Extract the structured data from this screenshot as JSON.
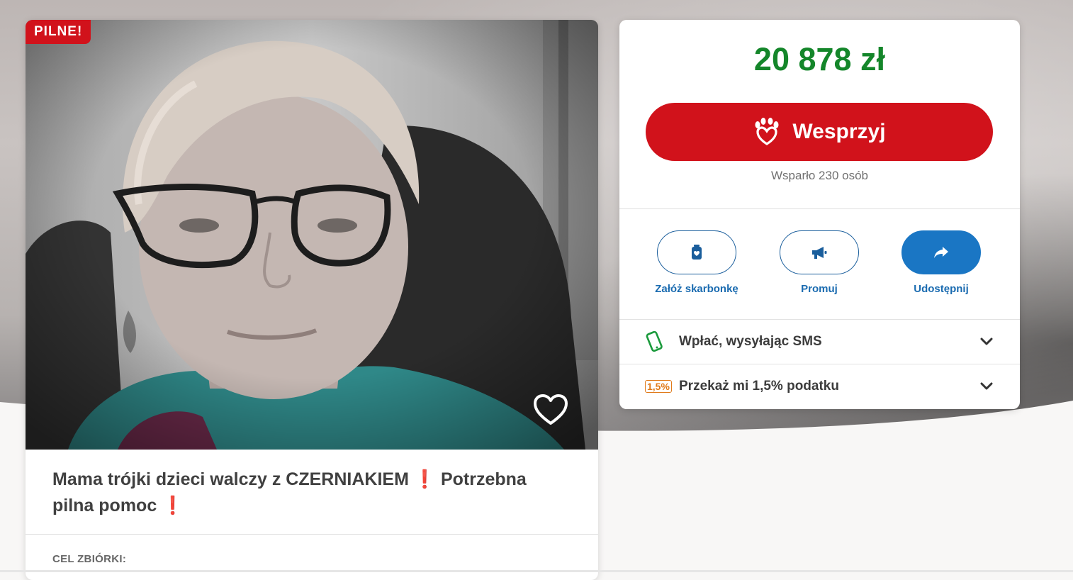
{
  "campaign": {
    "badge": "PILNE!",
    "title_part1": "Mama trójki dzieci walczy z CZERNIAKIEM",
    "title_excl1": "❗",
    "title_part2": " Potrzebna pilna pomoc",
    "title_excl2": "❗",
    "goal_label": "CEL ZBIÓRKI:"
  },
  "panel": {
    "amount": "20 878 zł",
    "support_button": "Wesprzyj",
    "supporters": "Wsparło 230 osób",
    "actions": [
      {
        "label": "Załóż skarbonkę",
        "icon": "piggy-bank-icon"
      },
      {
        "label": "Promuj",
        "icon": "megaphone-icon"
      },
      {
        "label": "Udostępnij",
        "icon": "share-icon"
      }
    ],
    "rows": [
      {
        "label": "Wpłać, wysyłając SMS",
        "icon": "phone-icon"
      },
      {
        "label": "Przekaż mi 1,5% podatku",
        "icon": "tax-percent-icon",
        "icon_text": "1,5%"
      }
    ]
  },
  "colors": {
    "accent_red": "#d1121b",
    "amount_green": "#14862a",
    "action_blue": "#1a76c4"
  }
}
